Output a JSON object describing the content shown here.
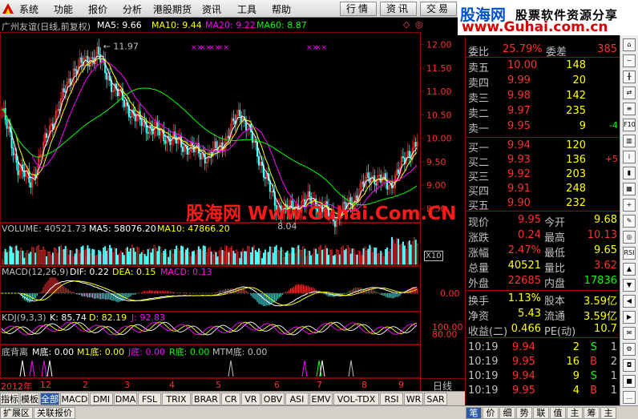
{
  "menu": {
    "items": [
      "系统",
      "功能",
      "报价",
      "分析",
      "港股期货",
      "资讯",
      "工具",
      "帮助"
    ],
    "tabs": [
      "行情",
      "资讯",
      "交易"
    ]
  },
  "banner": {
    "brand_cn": "股海网",
    "brand_tagline": "股票软件资源分享",
    "brand_url": "www.Guhai.com.cn"
  },
  "watermark": {
    "text": "股海网 Www.Guhai.Com.CN"
  },
  "main_chart": {
    "title": "广州友谊(日线,前复权)",
    "ma": [
      {
        "label": "MA5: 9.66",
        "color": "#ffffff"
      },
      {
        "label": "MA10: 9.44",
        "color": "#ffff00"
      },
      {
        "label": "MA20: 9.22",
        "color": "#ff00ff"
      },
      {
        "label": "MA60: 8.87",
        "color": "#00ff00"
      }
    ],
    "high_label": "11.97",
    "low_label": "8.04",
    "y_ticks": [
      "12.00",
      "11.50",
      "11.00",
      "10.50",
      "10.00",
      "9.50",
      "9.00",
      "8.50"
    ]
  },
  "volume_panel": {
    "labels": [
      {
        "text": "VOLUME: 40521.73",
        "color": "#c0c0c0"
      },
      {
        "text": "MA5: 58076.20",
        "color": "#ffffff"
      },
      {
        "text": "MA10: 47866.20",
        "color": "#ffff00"
      }
    ],
    "unit": "X10"
  },
  "macd_panel": {
    "labels": [
      {
        "text": "MACD(12,26,9)",
        "color": "#c0c0c0"
      },
      {
        "text": "DIF: 0.22",
        "color": "#ffffff"
      },
      {
        "text": "DEA: 0.15",
        "color": "#ffff00"
      },
      {
        "text": "MACD: 0.13",
        "color": "#ff00ff"
      }
    ],
    "y_tick": "0.00"
  },
  "kdj_panel": {
    "labels": [
      {
        "text": "KDJ(9,3,3)",
        "color": "#c0c0c0"
      },
      {
        "text": "K: 85.74",
        "color": "#ffffff"
      },
      {
        "text": "D: 82.19",
        "color": "#ffff00"
      },
      {
        "text": "J: 92.83",
        "color": "#ff00ff"
      }
    ],
    "y_ticks": [
      "100.00",
      "80.00"
    ]
  },
  "bottom_panel": {
    "labels": [
      {
        "text": "底背离",
        "color": "#c0c0c0"
      },
      {
        "text": "M底: 0.00",
        "color": "#ffffff"
      },
      {
        "text": "M1底: 0.00",
        "color": "#ffff00"
      },
      {
        "text": "J底: 0.00",
        "color": "#ff00ff"
      },
      {
        "text": "R底: 0.00",
        "color": "#00ff00"
      },
      {
        "text": "MTM底: 0.00",
        "color": "#c0c0c0"
      }
    ]
  },
  "x_axis": {
    "labels": [
      "2012年",
      "12",
      "2",
      "3",
      "4",
      "5",
      "6",
      "7",
      "8",
      "9"
    ],
    "period": "日线"
  },
  "quote": {
    "weibi_label": "委比",
    "weibi_value": "25.79%",
    "weicha_label": "委差",
    "weicha_value": "385",
    "asks": [
      {
        "label": "卖五",
        "price": "10.00",
        "vol": "148",
        "chg": ""
      },
      {
        "label": "卖四",
        "price": "9.99",
        "vol": "20",
        "chg": ""
      },
      {
        "label": "卖三",
        "price": "9.98",
        "vol": "142",
        "chg": ""
      },
      {
        "label": "卖二",
        "price": "9.97",
        "vol": "235",
        "chg": ""
      },
      {
        "label": "卖一",
        "price": "9.95",
        "vol": "9",
        "chg": "-4"
      }
    ],
    "bids": [
      {
        "label": "买一",
        "price": "9.94",
        "vol": "120",
        "chg": ""
      },
      {
        "label": "买二",
        "price": "9.93",
        "vol": "136",
        "chg": "+5"
      },
      {
        "label": "买三",
        "price": "9.92",
        "vol": "203",
        "chg": ""
      },
      {
        "label": "买四",
        "price": "9.91",
        "vol": "248",
        "chg": ""
      },
      {
        "label": "买五",
        "price": "9.90",
        "vol": "232",
        "chg": ""
      }
    ],
    "stats": [
      {
        "l1": "现价",
        "v1": "9.95",
        "c1": "#ff3030",
        "l2": "今开",
        "v2": "9.68",
        "c2": "#ffff00"
      },
      {
        "l1": "涨跌",
        "v1": "0.24",
        "c1": "#ff3030",
        "l2": "最高",
        "v2": "10.13",
        "c2": "#ff3030"
      },
      {
        "l1": "涨幅",
        "v1": "2.47%",
        "c1": "#ff3030",
        "l2": "最低",
        "v2": "9.65",
        "c2": "#ffff00"
      },
      {
        "l1": "总量",
        "v1": "40521",
        "c1": "#ffff00",
        "l2": "量比",
        "v2": "3.62",
        "c2": "#ff3030"
      },
      {
        "l1": "外盘",
        "v1": "22685",
        "c1": "#ff3030",
        "l2": "内盘",
        "v2": "17836",
        "c2": "#00ff00"
      }
    ],
    "stats2": [
      {
        "l1": "换手",
        "v1": "1.13%",
        "l2": "股本",
        "v2": "3.59亿"
      },
      {
        "l1": "净资",
        "v1": "5.43",
        "l2": "流通",
        "v2": "3.59亿"
      },
      {
        "l1": "收益(二)",
        "v1": "0.466",
        "l2": "PE(动)",
        "v2": "10.7"
      }
    ],
    "ticks": [
      {
        "time": "10:19",
        "price": "9.94",
        "vol": "2",
        "side": "S",
        "flag": "1"
      },
      {
        "time": "10:19",
        "price": "9.95",
        "vol": "16",
        "side": "B",
        "flag": "2"
      },
      {
        "time": "10:19",
        "price": "9.94",
        "vol": "9",
        "side": "S",
        "flag": "1"
      },
      {
        "time": "10:19",
        "price": "9.95",
        "vol": "4",
        "side": "B",
        "flag": "1"
      }
    ]
  },
  "indicator_tabs": [
    "指标",
    "模板",
    "全部",
    "MACD",
    "DMI",
    "DMA",
    "FSL",
    "TRIX",
    "BRAR",
    "CR",
    "VR",
    "OBV",
    "ASI",
    "EMV",
    "VOL-TDX",
    "RSI",
    "WR",
    "SAR"
  ],
  "status_bar": {
    "left_items": [
      "扩展区",
      "关联报价"
    ],
    "right_tabs": [
      "笔",
      "价",
      "细",
      "势",
      "联",
      "值",
      "主",
      "筹",
      "主"
    ]
  },
  "right_toolbar": [
    "F10",
    "RSI"
  ],
  "colors": {
    "up": "#ff3030",
    "down": "#00ff00",
    "ma5": "#ffffff",
    "ma10": "#ffff00",
    "ma20": "#ff00ff",
    "ma60": "#00ff00",
    "grid": "#8b0000"
  }
}
